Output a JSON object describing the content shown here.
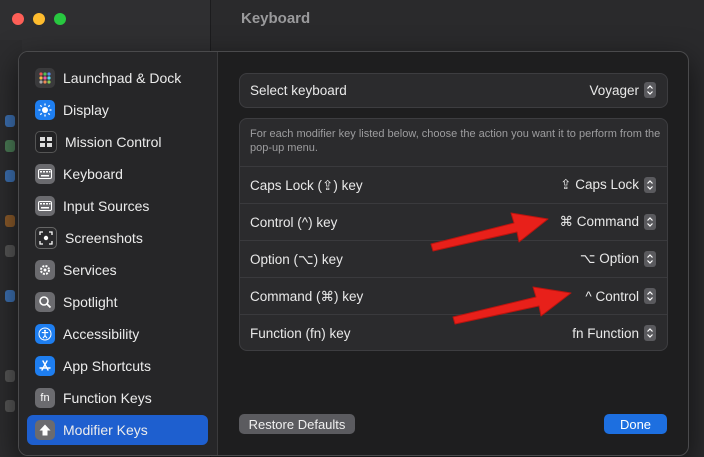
{
  "window": {
    "title": "Keyboard"
  },
  "sidebar": {
    "items": [
      {
        "label": "Launchpad & Dock",
        "icon": "launchpad-icon",
        "color": "#3a3a3c"
      },
      {
        "label": "Display",
        "icon": "sun-icon",
        "color": "#1e7ef0"
      },
      {
        "label": "Mission Control",
        "icon": "mission-control-icon",
        "color": "#222224"
      },
      {
        "label": "Keyboard",
        "icon": "keyboard-icon",
        "color": "#6b6b6f"
      },
      {
        "label": "Input Sources",
        "icon": "keyboard-icon",
        "color": "#6b6b6f"
      },
      {
        "label": "Screenshots",
        "icon": "screenshot-icon",
        "color": "#2a2a2c"
      },
      {
        "label": "Services",
        "icon": "gear-icon",
        "color": "#6b6b6f"
      },
      {
        "label": "Spotlight",
        "icon": "magnifier-icon",
        "color": "#6b6b6f"
      },
      {
        "label": "Accessibility",
        "icon": "accessibility-icon",
        "color": "#1e7ef0"
      },
      {
        "label": "App Shortcuts",
        "icon": "app-store-icon",
        "color": "#1e7ef0"
      },
      {
        "label": "Function Keys",
        "icon": "fn-icon",
        "color": "#6b6b6f"
      },
      {
        "label": "Modifier Keys",
        "icon": "modifier-icon",
        "color": "#6b6b6f",
        "active": true
      }
    ]
  },
  "main": {
    "select_keyboard": {
      "label": "Select keyboard",
      "value": "Voyager"
    },
    "description": "For each modifier key listed below, choose the action you want it to perform from the pop-up menu.",
    "rows": [
      {
        "label": "Caps Lock (⇪) key",
        "value": "⇪ Caps Lock"
      },
      {
        "label": "Control (^) key",
        "value": "⌘ Command"
      },
      {
        "label": "Option (⌥) key",
        "value": "⌥ Option"
      },
      {
        "label": "Command (⌘) key",
        "value": "^ Control"
      },
      {
        "label": "Function (fn) key",
        "value": "fn Function"
      }
    ]
  },
  "buttons": {
    "restore": "Restore Defaults",
    "done": "Done"
  },
  "colors": {
    "accent": "#1e5fcf",
    "annotation_arrow": "#e8201a"
  }
}
